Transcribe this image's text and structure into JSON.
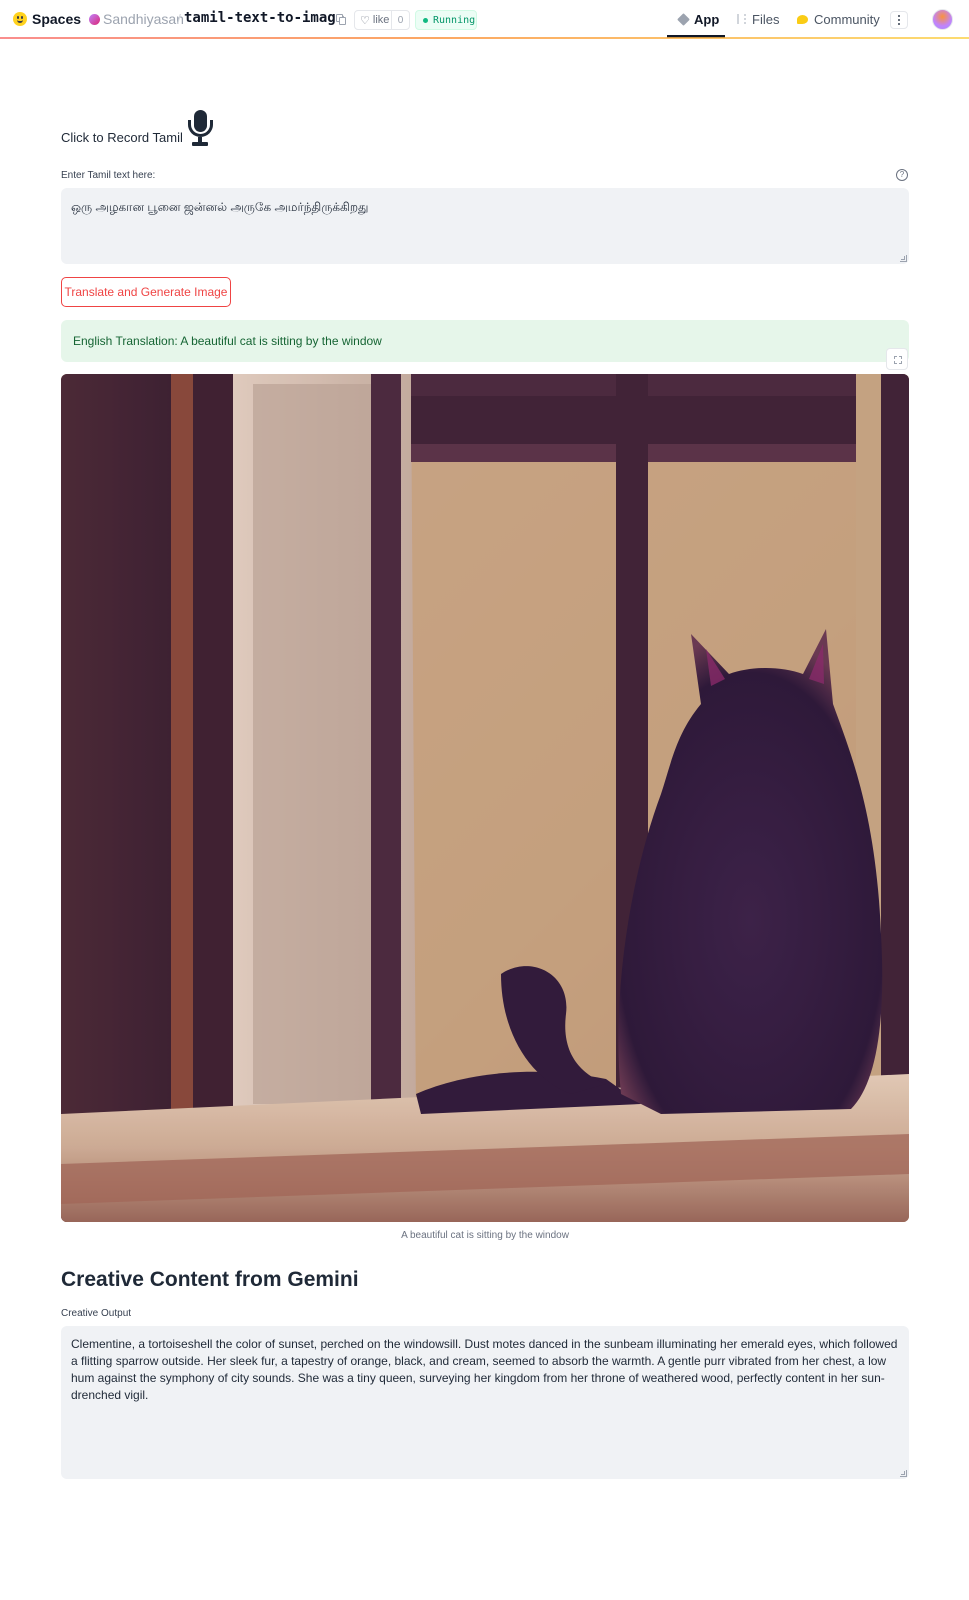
{
  "header": {
    "brand": "Spaces",
    "owner": "Sandhiyasan",
    "separator": "/",
    "repo": "tamil-text-to-image",
    "like_label": "like",
    "like_count": "0",
    "status": "Running",
    "nav": {
      "app": "App",
      "files": "Files",
      "community": "Community"
    },
    "accent_gradient": [
      "#f87171",
      "#fb923c",
      "#fcd34d"
    ]
  },
  "record": {
    "label": "Click to Record Tamil",
    "icon": "microphone-icon"
  },
  "tamil_input": {
    "label": "Enter Tamil text here:",
    "value": "ஒரு அழகான பூனை ஜன்னல் அருகே அமர்ந்திருக்கிறது"
  },
  "generate_button": {
    "label": "Translate and Generate Image",
    "color": "#ef4444"
  },
  "translation": {
    "text": "English Translation: A beautiful cat is sitting by the window"
  },
  "image": {
    "caption": "A beautiful cat is sitting by the window"
  },
  "creative": {
    "heading": "Creative Content from Gemini",
    "label": "Creative Output",
    "text": "Clementine, a tortoiseshell the color of sunset, perched on the windowsill.  Dust motes danced in the sunbeam illuminating her emerald eyes, which followed a flitting sparrow outside.  Her sleek fur, a tapestry of orange, black, and cream, seemed to absorb the warmth.  A gentle purr vibrated from her chest, a low hum against the symphony of city sounds.  She was a tiny queen, surveying her kingdom from her throne of weathered wood, perfectly content in her sun-drenched vigil."
  }
}
